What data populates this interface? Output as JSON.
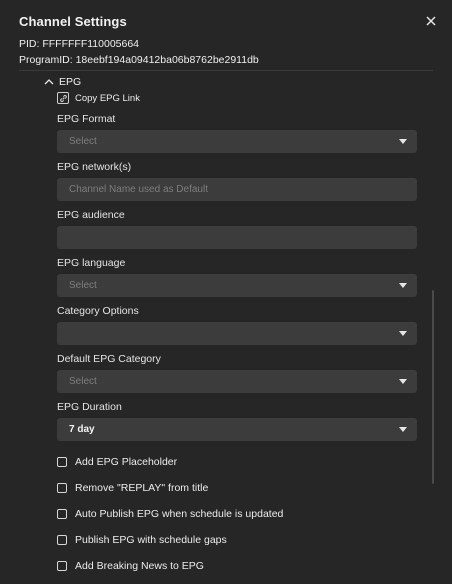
{
  "dialog": {
    "title": "Channel Settings",
    "pid": "PID: FFFFFFF110005664",
    "program_id": "ProgramID: 18eebf194a09412ba06b8762be2911db"
  },
  "epg_section": {
    "heading": "EPG",
    "copy_link_label": "Copy EPG Link"
  },
  "fields": {
    "epg_format": {
      "label": "EPG Format",
      "value": "Select"
    },
    "epg_network": {
      "label": "EPG network(s)",
      "placeholder": "Channel Name used as Default"
    },
    "epg_audience": {
      "label": "EPG audience",
      "value": ""
    },
    "epg_language": {
      "label": "EPG language",
      "value": "Select"
    },
    "category_options": {
      "label": "Category Options",
      "value": ""
    },
    "default_epg_category": {
      "label": "Default EPG Category",
      "value": "Select"
    },
    "epg_duration": {
      "label": "EPG Duration",
      "value": "7 day"
    }
  },
  "checkboxes": [
    {
      "label": "Add EPG Placeholder",
      "checked": false
    },
    {
      "label": "Remove \"REPLAY\" from title",
      "checked": false
    },
    {
      "label": "Auto Publish EPG when schedule is updated",
      "checked": false
    },
    {
      "label": "Publish EPG with schedule gaps",
      "checked": false
    },
    {
      "label": "Add Breaking News to EPG",
      "checked": false
    }
  ]
}
